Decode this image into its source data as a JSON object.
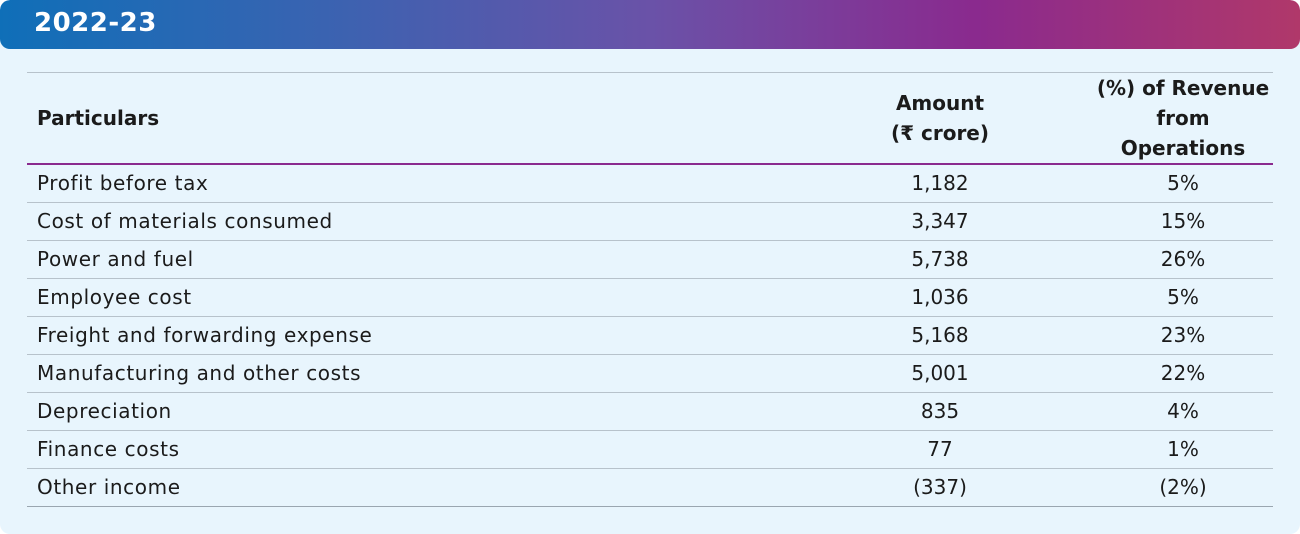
{
  "header": {
    "title": "2022-23"
  },
  "table": {
    "columns": {
      "particulars": "Particulars",
      "amount_line1": "Amount",
      "amount_line2": "(₹ crore)",
      "pct_line1": "(%) of Revenue",
      "pct_line2": "from Operations"
    },
    "rows": [
      {
        "particular": "Profit before tax",
        "amount": "1,182",
        "pct": "5%"
      },
      {
        "particular": "Cost of materials consumed",
        "amount": "3,347",
        "pct": "15%"
      },
      {
        "particular": "Power and fuel",
        "amount": "5,738",
        "pct": "26%"
      },
      {
        "particular": "Employee cost",
        "amount": "1,036",
        "pct": "5%"
      },
      {
        "particular": "Freight and forwarding expense",
        "amount": "5,168",
        "pct": "23%"
      },
      {
        "particular": "Manufacturing and other costs",
        "amount": "5,001",
        "pct": "22%"
      },
      {
        "particular": "Depreciation",
        "amount": "835",
        "pct": "4%"
      },
      {
        "particular": "Finance costs",
        "amount": "77",
        "pct": "1%"
      },
      {
        "particular": "Other income",
        "amount": "(337)",
        "pct": "(2%)"
      }
    ]
  }
}
